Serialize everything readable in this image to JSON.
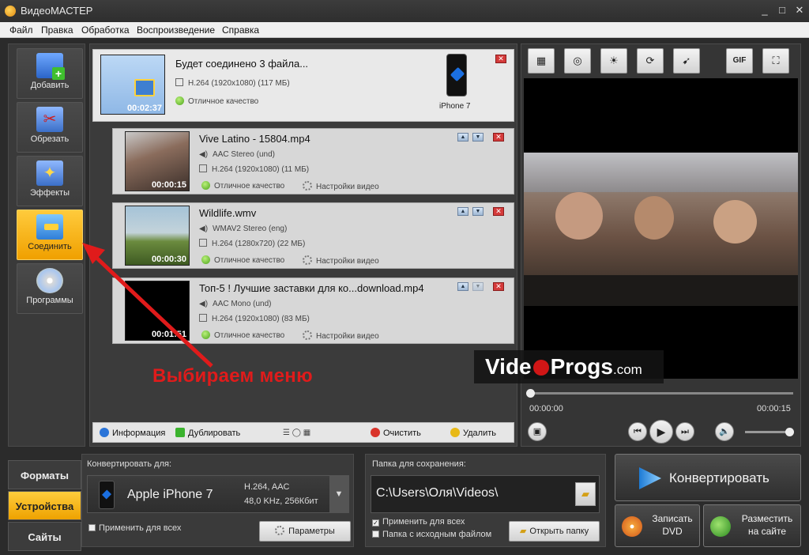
{
  "window": {
    "title": "ВидеоМАСТЕР",
    "controls": [
      "_",
      "□",
      "✕"
    ]
  },
  "menu": [
    "Файл",
    "Правка",
    "Обработка",
    "Воспроизведение",
    "Справка"
  ],
  "tools": [
    {
      "label": "Добавить",
      "icon": "add-film-icon"
    },
    {
      "label": "Обрезать",
      "icon": "scissors-icon"
    },
    {
      "label": "Эффекты",
      "icon": "magic-wand-icon"
    },
    {
      "label": "Соединить",
      "icon": "join-film-icon",
      "active": true
    },
    {
      "label": "Программы",
      "icon": "disc-icon"
    }
  ],
  "join": {
    "title": "Будет соединено 3 файла...",
    "codec": "H.264 (1920x1080) (117 МБ)",
    "quality": "Отличное качество",
    "duration": "00:02:37",
    "device": "iPhone 7"
  },
  "clips": [
    {
      "name": "Vive Latino - 15804.mp4",
      "audio": "AAC Stereo (und)",
      "video": "H.264 (1920x1080) (11 МБ)",
      "quality": "Отличное качество",
      "settings": "Настройки видео",
      "duration": "00:00:15",
      "checked": "✓"
    },
    {
      "name": "Wildlife.wmv",
      "audio": "WMAV2 Stereo (eng)",
      "video": "H.264 (1280x720) (22 МБ)",
      "quality": "Отличное качество",
      "settings": "Настройки видео",
      "duration": "00:00:30",
      "checked": "✓"
    },
    {
      "name": "Топ-5 ! Лучшие заставки для ко...download.mp4",
      "audio": "AAC Mono (und)",
      "video": "H.264 (1920x1080) (83 МБ)",
      "quality": "Отличное качество",
      "settings": "Настройки видео",
      "duration": "00:01:51",
      "checked": "✓"
    }
  ],
  "center_toolbar": {
    "info": "Информация",
    "duplicate": "Дублировать",
    "clear": "Очистить",
    "delete": "Удалить"
  },
  "annotation": "Выбираем меню",
  "watermark": {
    "left": "Vide",
    "right": "Progs",
    "suffix": ".com"
  },
  "player": {
    "tools": [
      "crop-icon",
      "stabilize-icon",
      "brightness-icon",
      "rotate-icon",
      "speed-icon",
      "gif-icon",
      "fullscreen-icon"
    ],
    "gif_label": "GIF",
    "time_current": "00:00:00",
    "time_total": "00:00:15",
    "progress": 0,
    "volume": 1.0
  },
  "bottom_tabs": [
    {
      "label": "Форматы"
    },
    {
      "label": "Устройства",
      "active": true
    },
    {
      "label": "Сайты"
    }
  ],
  "convert": {
    "label": "Конвертировать для:",
    "device": "Apple iPhone 7",
    "spec1": "H.264, AAC",
    "spec2": "48,0 KHz, 256Кбит",
    "apply_all": "Применить для всех",
    "params": "Параметры"
  },
  "save": {
    "label": "Папка для сохранения:",
    "path": "C:\\Users\\Оля\\Videos\\",
    "apply_all": "Применить для всех",
    "source_folder": "Папка с исходным файлом",
    "open_folder": "Открыть папку"
  },
  "actions": {
    "convert": "Конвертировать",
    "dvd_line1": "Записать",
    "dvd_line2": "DVD",
    "publish_line1": "Разместить",
    "publish_line2": "на сайте"
  },
  "colors": {
    "accent": "#f2a900",
    "annotation": "#e01b1b",
    "dark": "#2b2b2b"
  }
}
